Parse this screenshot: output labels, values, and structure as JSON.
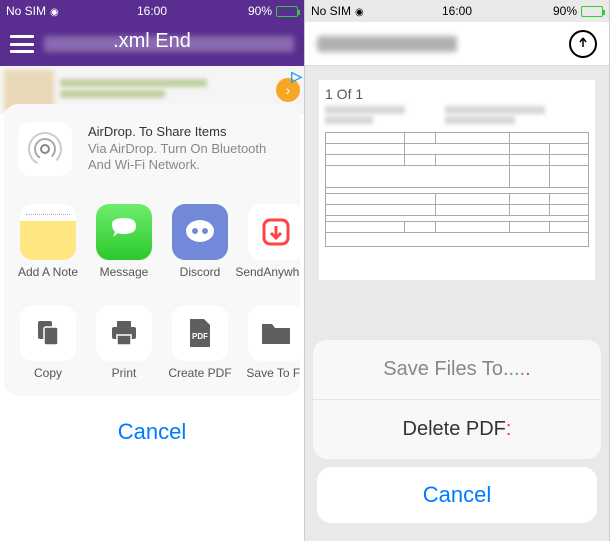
{
  "left": {
    "status": {
      "carrier": "No SIM",
      "time": "16:00",
      "battery_pct": "90%"
    },
    "header": {
      "title": ".xml End"
    },
    "airdrop": {
      "title": "AirDrop. To Share Items",
      "subtitle": "Via AirDrop. Turn On Bluetooth And Wi-Fi Network."
    },
    "apps": [
      {
        "label": "Add\nA Note",
        "icon": "notes"
      },
      {
        "label": "Message",
        "icon": "messages"
      },
      {
        "label": "Discord",
        "icon": "discord"
      },
      {
        "label": "SendAnywhere",
        "icon": "sendanywhere"
      }
    ],
    "actions": [
      {
        "label": "Copy",
        "icon": "copy"
      },
      {
        "label": "Print",
        "icon": "print"
      },
      {
        "label": "Create PDF",
        "icon": "pdf"
      },
      {
        "label": "Save To Fil",
        "icon": "folder"
      }
    ],
    "cancel": "Cancel"
  },
  "right": {
    "status": {
      "carrier": "No SIM",
      "time": "16:00",
      "battery_pct": "90%"
    },
    "doc": {
      "page_label": "1 Of 1"
    },
    "sheet": {
      "save_files": "Save Files To....",
      "delete_pdf": "Delete PDF",
      "cancel": "Cancel"
    }
  }
}
